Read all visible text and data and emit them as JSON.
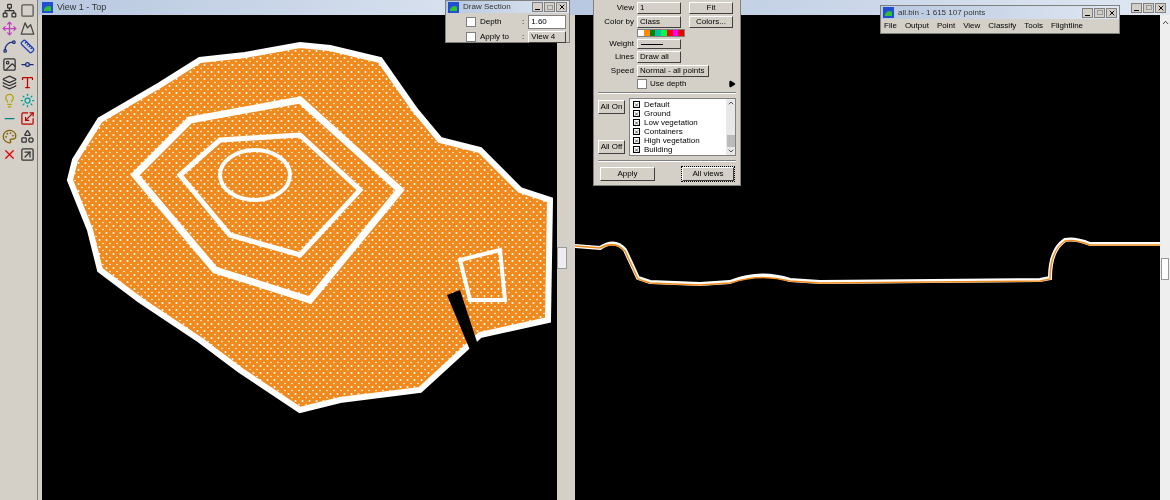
{
  "view_top": {
    "title": "View 1 - Top"
  },
  "draw_section": {
    "title": "Draw Section",
    "depth": {
      "label": "Depth",
      "separator": ":",
      "checked": false,
      "value": "1.60"
    },
    "apply_to": {
      "label": "Apply to",
      "separator": ":",
      "checked": false,
      "value": "View 4"
    }
  },
  "display_mode": {
    "view": {
      "label": "View",
      "value": "1"
    },
    "fit_button": "Fit",
    "color_by": {
      "label": "Color by",
      "value": "Class"
    },
    "colors_button": "Colors...",
    "palette": [
      {
        "color": "#ffffff"
      },
      {
        "color": "#ff8c00"
      },
      {
        "color": "#008000"
      },
      {
        "color": "#00c0a0"
      },
      {
        "color": "#00ff40"
      },
      {
        "color": "#ff0000"
      },
      {
        "color": "#ff00ff"
      },
      {
        "color": "#e00000"
      }
    ],
    "weight_label": "Weight",
    "lines": {
      "label": "Lines",
      "value": "Draw all"
    },
    "speed": {
      "label": "Speed",
      "value": "Normal - all points"
    },
    "use_depth": {
      "label": "Use depth",
      "checked": false
    },
    "all_on": "All On",
    "all_off": "All Off",
    "classes": [
      {
        "name": "Default",
        "checked": true
      },
      {
        "name": "Ground",
        "checked": true
      },
      {
        "name": "Low vegetation",
        "checked": true
      },
      {
        "name": "Containers",
        "checked": true
      },
      {
        "name": "High vegetation",
        "checked": true
      },
      {
        "name": "Building",
        "checked": true
      }
    ],
    "apply": "Apply",
    "all_views": "All views"
  },
  "terrascan": {
    "title": "all.bin - 1 615 107 points",
    "menu": [
      "File",
      "Output",
      "Point",
      "View",
      "Classify",
      "Tools",
      "Flightline"
    ]
  }
}
